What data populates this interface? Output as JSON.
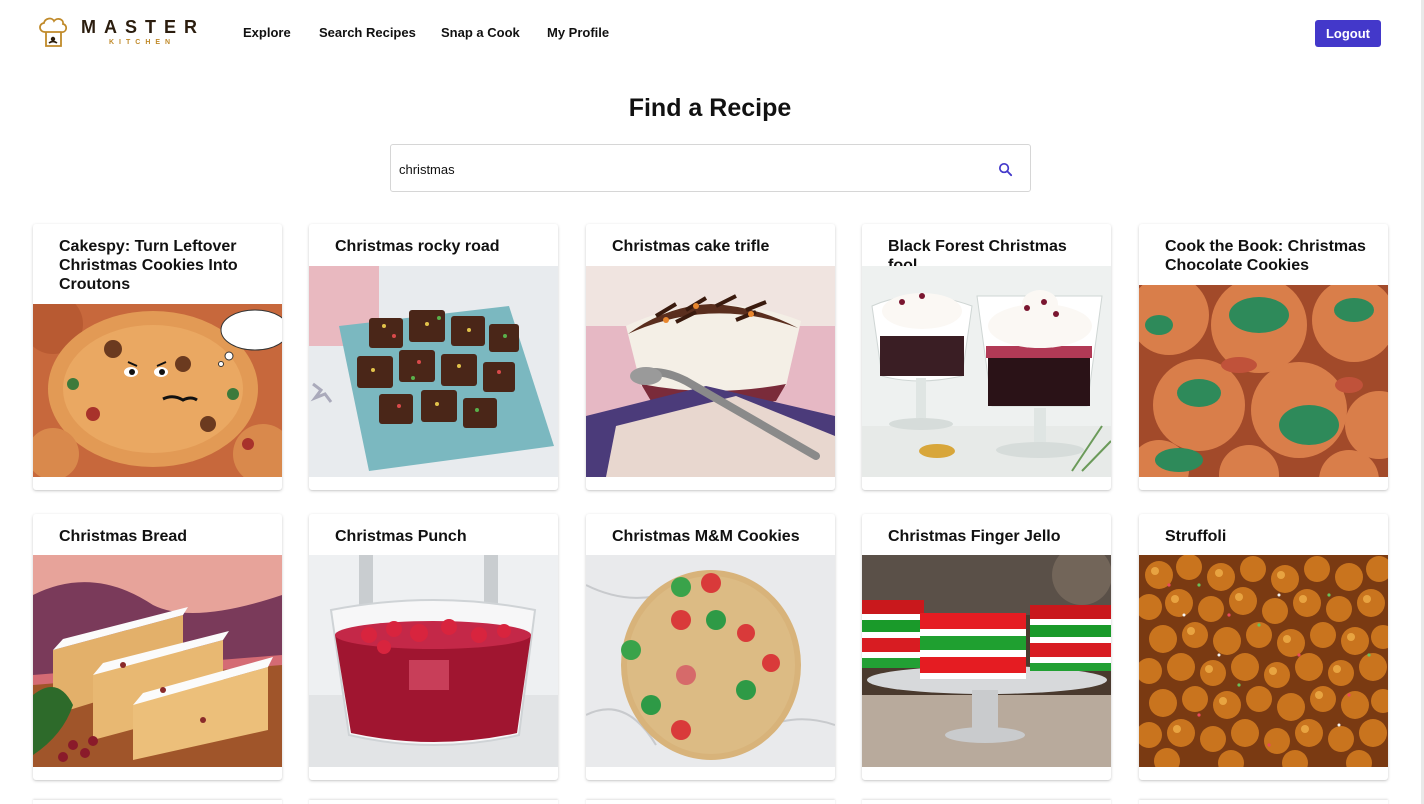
{
  "brand": {
    "name": "MASTER",
    "sub": "KITCHEN"
  },
  "nav": {
    "links": [
      "Explore",
      "Search Recipes",
      "Snap a Cook",
      "My Profile"
    ],
    "logout_label": "Logout"
  },
  "search": {
    "title": "Find a Recipe",
    "value": "christmas",
    "placeholder": ""
  },
  "recipes": [
    {
      "title": "Cakespy: Turn Leftover Christmas Cookies Into Croutons",
      "image_icon": "cookie-croutons-image",
      "bubble_text": "I'M all DRIED"
    },
    {
      "title": "Christmas rocky road",
      "image_icon": "rocky-road-image"
    },
    {
      "title": "Christmas cake trifle",
      "image_icon": "trifle-image"
    },
    {
      "title": "Black Forest Christmas fool",
      "image_icon": "fool-dessert-image"
    },
    {
      "title": "Cook the Book: Christmas Chocolate Cookies",
      "image_icon": "chocolate-cookies-image"
    },
    {
      "title": "Christmas Bread",
      "image_icon": "stollen-bread-image"
    },
    {
      "title": "Christmas Punch",
      "image_icon": "punch-glass-image"
    },
    {
      "title": "Christmas M&M Cookies",
      "image_icon": "mm-cookie-image"
    },
    {
      "title": "Christmas Finger Jello",
      "image_icon": "finger-jello-image"
    },
    {
      "title": "Struffoli",
      "image_icon": "struffoli-image"
    }
  ],
  "colors": {
    "accent": "#4338ca",
    "logo_dark": "#2b1d0e",
    "logo_gold": "#c08a2a"
  }
}
